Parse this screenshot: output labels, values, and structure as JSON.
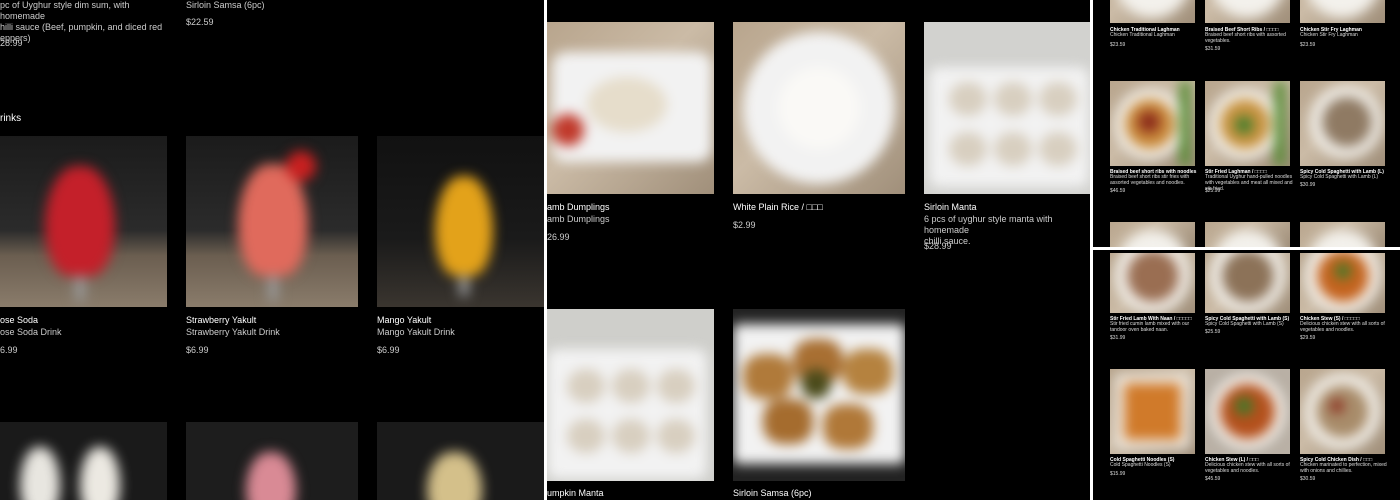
{
  "panel1": {
    "top_item_a": {
      "desc_lines": [
        "pc of Uyghur style dim sum, with homemade",
        "hilli sauce (Beef, pumpkin, and diced red",
        "eppers)"
      ],
      "price": "28.99"
    },
    "top_item_b": {
      "name": "Sirloin Samsa (6pc)",
      "price": "$22.59"
    },
    "section_title": "rinks",
    "drinks": [
      {
        "name": "ose Soda",
        "desc": "ose Soda Drink",
        "price": "6.99",
        "color": "#c4202a"
      },
      {
        "name": "Strawberry Yakult",
        "desc": "Strawberry Yakult Drink",
        "price": "$6.99",
        "color": "#e06a5c"
      },
      {
        "name": "Mango Yakult",
        "desc": "Mango Yakult Drink",
        "price": "$6.99",
        "color": "#e3a21a"
      }
    ]
  },
  "panel2": {
    "items": [
      {
        "name": "amb Dumplings",
        "desc": "amb Dumplings",
        "price": "26.99"
      },
      {
        "name": "White Plain Rice / □□□",
        "price": "$2.99"
      },
      {
        "name": "Sirloin Manta",
        "desc_lines": [
          "6 pcs of uyghur style manta with homemade",
          "chilli sauce."
        ],
        "price": "$28.99"
      },
      {
        "name": "umpkin Manta"
      },
      {
        "name": "Sirloin Samsa (6pc)"
      }
    ]
  },
  "panel3": {
    "row0": [
      {
        "name": "Chicken Traditional Laghman",
        "desc": "Chicken Traditional Laghman",
        "price": "$23.59"
      },
      {
        "name": "Braised Beef Short Ribs / □□□□",
        "desc": "Braised beef short ribs with assorted vegetables.",
        "price": "$31.59"
      },
      {
        "name": "Chicken Stir Fry Laghman",
        "desc": "Chicken Stir Fry Laghman",
        "price": "$23.59"
      }
    ],
    "row1": [
      {
        "name": "Braised beef short ribs with noodles",
        "desc": "Braised beef short ribs stir fries with assorted vegetables and noodles.",
        "price": "$46.59"
      },
      {
        "name": "Stir Fried Laghman / □□□□",
        "desc": "Traditional Uyghur hand-pulled noodles with vegetables and meat all mixed and stir fried.",
        "price": "$25.99"
      },
      {
        "name": "Spicy Cold Spaghetti with Lamb (L)",
        "desc": "Spicy Cold Spaghetti with Lamb (L)",
        "price": "$30.99"
      }
    ],
    "row2": [
      {
        "name": "Stir Fried Lamb With Naan / □□□□□",
        "desc": "Stir fried cumin lamb mixed with our tandoor oven baked naan.",
        "price": "$31.99"
      },
      {
        "name": "Spicy Cold Spaghetti with Lamb (S)",
        "desc": "Spicy Cold Spaghetti with Lamb (S)",
        "price": "$25.59"
      },
      {
        "name": "Chicken Stew (S) / □□□□□",
        "desc": "Delicious chicken stew with all sorts of vegetables and noodles.",
        "price": "$29.59"
      }
    ],
    "row3": [
      {
        "name": "Cold Spaghetti Noodles (S)",
        "desc": "Cold Spaghetti Noodles (S)",
        "price": "$15.99"
      },
      {
        "name": "Chicken Stew (L) / □□□",
        "desc": "Delicious chicken stew with all sorts of vegetables and noodles.",
        "price": "$45.59"
      },
      {
        "name": "Spicy Cold Chicken Dish / □□□",
        "desc": "Chicken marinated to perfection, mixed with onions and chillies.",
        "price": "$30.59"
      }
    ]
  }
}
